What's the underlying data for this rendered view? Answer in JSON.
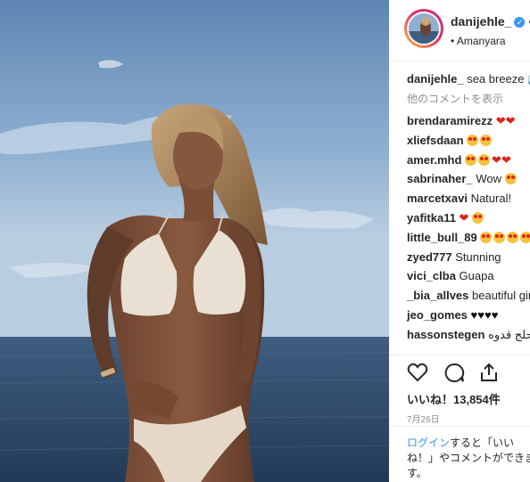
{
  "post": {
    "username": "danijehle_",
    "follow_dot": "•",
    "location": "• Amanyara",
    "caption_user": "danijehle_",
    "caption_text": " sea breeze 🌊",
    "more_comments": "他のコメントを表示",
    "likes": "いいね！13,854件",
    "date": "7月26日",
    "login_link": "ログイン",
    "login_text": "すると「いいね！」やコメントができます。"
  },
  "comments": [
    {
      "user": "brendaramirezz",
      "text": " ❤❤"
    },
    {
      "user": "xliefsdaan",
      "text": ""
    },
    {
      "user": "amer.mhd",
      "text": ""
    },
    {
      "user": "sabrinaher_",
      "text": " Wow"
    },
    {
      "user": "marcetxavi",
      "text": " Natural!"
    },
    {
      "user": "yafitka11",
      "text": " ❤"
    },
    {
      "user": "little_bull_89",
      "text": ""
    },
    {
      "user": "zyed777",
      "text": " Stunning"
    },
    {
      "user": "vici_clba",
      "text": " Guapa"
    },
    {
      "user": "_bia_allves",
      "text": " beautiful girl"
    },
    {
      "user": "jeo_gomes",
      "text": " ♥♥♥♥"
    },
    {
      "user": "hassonstegen",
      "text": " حلج قدوه"
    }
  ],
  "icons": {
    "like": "heart-outline-icon",
    "comment": "comment-bubble-icon",
    "share": "share-upload-icon",
    "verified": "verified-badge-icon"
  },
  "colors": {
    "link": "#3897f0",
    "heart": "#e0221c",
    "sky_top": "#6a8fb9",
    "sea": "#2e4a6b"
  }
}
